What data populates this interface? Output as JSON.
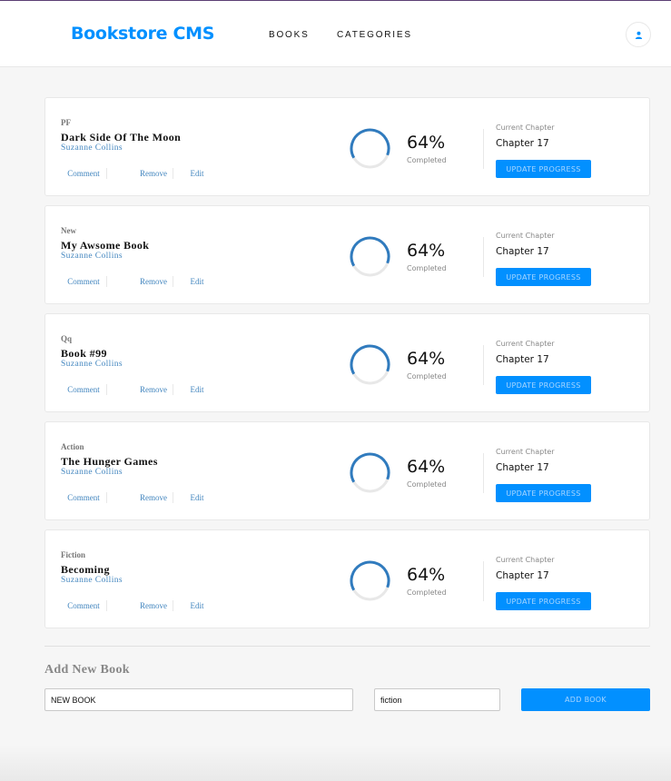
{
  "header": {
    "logo": "Bookstore CMS",
    "nav": [
      {
        "label": "BOOKS"
      },
      {
        "label": "CATEGORIES"
      }
    ],
    "user_icon": "user-icon"
  },
  "colors": {
    "accent": "#0290ff",
    "ring": "#307bbe",
    "ring_track": "#e8e8e8",
    "link": "#4386bf"
  },
  "books": [
    {
      "genre": "PF",
      "title": "Dark Side Of The Moon",
      "author": "Suzanne Collins",
      "progress": 0.64,
      "percent_label": "64%",
      "completed_label": "Completed",
      "chapter_label": "Current Chapter",
      "chapter": "Chapter 17",
      "update_label": "UPDATE PROGRESS"
    },
    {
      "genre": "New",
      "title": "My Awsome Book",
      "author": "Suzanne Collins",
      "progress": 0.64,
      "percent_label": "64%",
      "completed_label": "Completed",
      "chapter_label": "Current Chapter",
      "chapter": "Chapter 17",
      "update_label": "UPDATE PROGRESS"
    },
    {
      "genre": "Qq",
      "title": "Book #99",
      "author": "Suzanne Collins",
      "progress": 0.64,
      "percent_label": "64%",
      "completed_label": "Completed",
      "chapter_label": "Current Chapter",
      "chapter": "Chapter 17",
      "update_label": "UPDATE PROGRESS"
    },
    {
      "genre": "Action",
      "title": "The Hunger Games",
      "author": "Suzanne Collins",
      "progress": 0.64,
      "percent_label": "64%",
      "completed_label": "Completed",
      "chapter_label": "Current Chapter",
      "chapter": "Chapter 17",
      "update_label": "UPDATE PROGRESS"
    },
    {
      "genre": "Fiction",
      "title": "Becoming",
      "author": "Suzanne Collins",
      "progress": 0.64,
      "percent_label": "64%",
      "completed_label": "Completed",
      "chapter_label": "Current Chapter",
      "chapter": "Chapter 17",
      "update_label": "UPDATE PROGRESS"
    }
  ],
  "actions": {
    "comment": "Comment",
    "remove": "Remove",
    "edit": "Edit"
  },
  "form": {
    "title": "Add New Book",
    "title_value": "NEW BOOK",
    "category_value": "fiction",
    "submit_label": "ADD BOOK"
  }
}
